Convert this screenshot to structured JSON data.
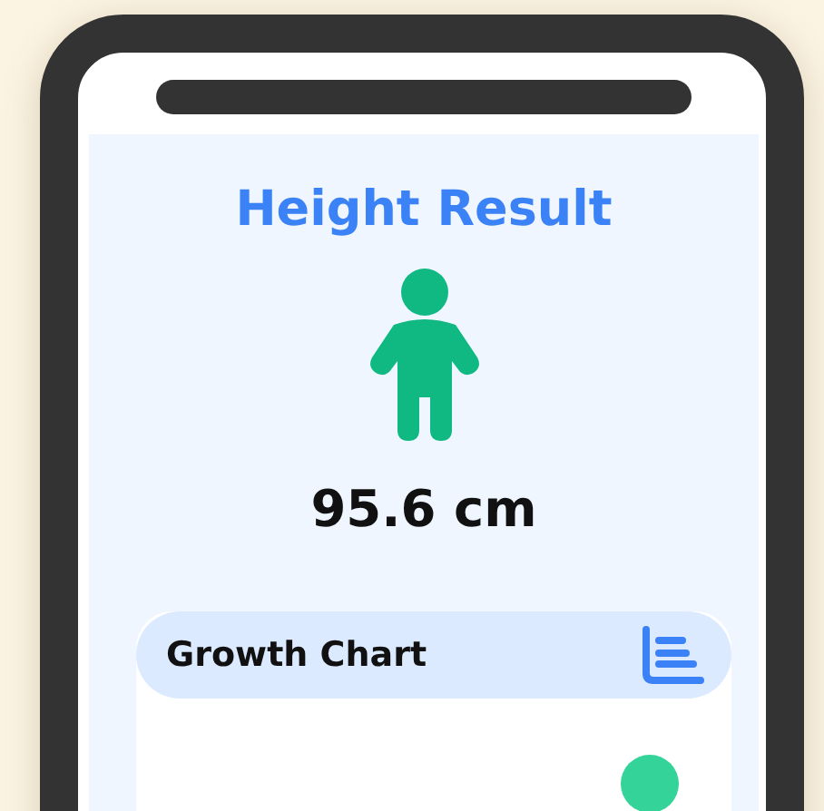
{
  "title": "Height Result",
  "height": "95.6 cm",
  "card": {
    "title": "Growth Chart"
  }
}
